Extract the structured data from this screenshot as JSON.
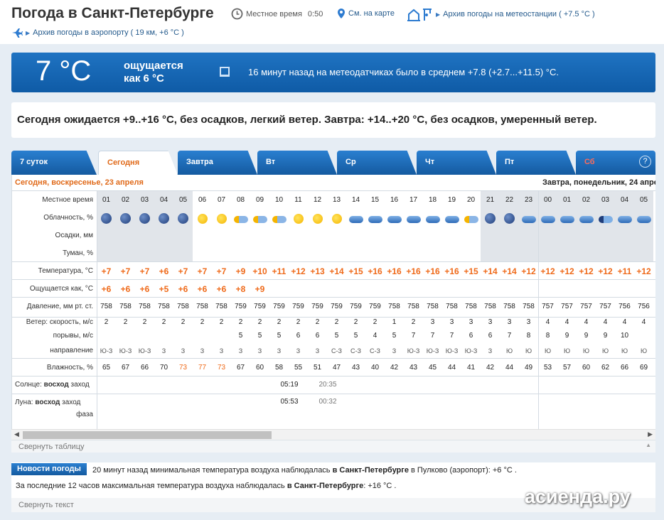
{
  "header": {
    "title": "Погода в Санкт-Петербурге",
    "local_time_label": "Местное время",
    "local_time": "0:50",
    "map_link": "См. на карте",
    "station_archive": "Архив погоды на метеостанции ( +7.5 °C )",
    "airport_archive": "Архив погоды в аэропорту ( 19 км, +6 °C )"
  },
  "current": {
    "temp": "7 °C",
    "feels_line1": "ощущается",
    "feels_line2": "как 6 °C",
    "sensors": "16 минут назад на метеодатчиках было в среднем +7.8 (+2.7...+11.5) °C."
  },
  "summary": "Сегодня ожидается +9..+16 °C, без осадков, легкий ветер. Завтра: +14..+20 °C, без осадков, умеренный ветер.",
  "tabs": [
    "7 суток",
    "Сегодня",
    "Завтра",
    "Вт",
    "Ср",
    "Чт",
    "Пт",
    "Сб"
  ],
  "help_label": "?",
  "table": {
    "today_header": "Сегодня, воскресенье, 23 апреля",
    "tomorrow_header": "Завтра, понедельник, 24 апреля",
    "row_labels": {
      "local_time": "Местное время",
      "cloud": "Облачность, %",
      "precip": "Осадки, мм",
      "fog": "Туман, %",
      "temp": "Температура, °C",
      "feels": "Ощущается как, °C",
      "pressure": "Давление, мм рт. ст.",
      "wind": "Ветер: скорость, м/с",
      "gusts": "порывы, м/с",
      "direction": "направление",
      "humidity": "Влажность, %",
      "sun": "Солнце:",
      "moon": "Луна:",
      "rise": "восход",
      "set": "заход",
      "phase": "фаза"
    },
    "hours": [
      "01",
      "02",
      "03",
      "04",
      "05",
      "06",
      "07",
      "08",
      "09",
      "10",
      "11",
      "12",
      "13",
      "14",
      "15",
      "16",
      "17",
      "18",
      "19",
      "20",
      "21",
      "22",
      "23",
      "00",
      "01",
      "02",
      "03",
      "04",
      "05"
    ],
    "cloud_icons": [
      "moon",
      "moon",
      "moon",
      "moon",
      "moon",
      "sun",
      "sun",
      "sun-cloud",
      "sun-cloud",
      "sun-cloud",
      "sun",
      "sun",
      "sun",
      "cloud",
      "cloud",
      "cloud",
      "cloud",
      "cloud",
      "cloud",
      "sun-cloud",
      "moon",
      "moon",
      "cloud",
      "cloud",
      "cloud",
      "cloud",
      "moon-cloud",
      "cloud",
      "cloud"
    ],
    "temps": [
      "+7",
      "+7",
      "+7",
      "+6",
      "+7",
      "+7",
      "+7",
      "+9",
      "+10",
      "+11",
      "+12",
      "+13",
      "+14",
      "+15",
      "+16",
      "+16",
      "+16",
      "+16",
      "+16",
      "+15",
      "+14",
      "+14",
      "+12",
      "+12",
      "+12",
      "+12",
      "+12",
      "+11",
      "+12"
    ],
    "feels": [
      "+6",
      "+6",
      "+6",
      "+5",
      "+6",
      "+6",
      "+6",
      "+8",
      "+9",
      "",
      "",
      "",
      "",
      "",
      "",
      "",
      "",
      "",
      "",
      "",
      "",
      "",
      "",
      "",
      "",
      "",
      "",
      "",
      ""
    ],
    "pressure": [
      "758",
      "758",
      "758",
      "758",
      "758",
      "758",
      "758",
      "759",
      "759",
      "759",
      "759",
      "759",
      "759",
      "759",
      "759",
      "758",
      "758",
      "758",
      "758",
      "758",
      "758",
      "758",
      "758",
      "757",
      "757",
      "757",
      "757",
      "756",
      "756"
    ],
    "wind": [
      "2",
      "2",
      "2",
      "2",
      "2",
      "2",
      "2",
      "2",
      "2",
      "2",
      "2",
      "2",
      "2",
      "2",
      "2",
      "1",
      "2",
      "3",
      "3",
      "3",
      "3",
      "3",
      "3",
      "4",
      "4",
      "4",
      "4",
      "4",
      "4"
    ],
    "gusts": [
      "",
      "",
      "",
      "",
      "",
      "",
      "",
      "5",
      "5",
      "5",
      "6",
      "6",
      "5",
      "5",
      "4",
      "5",
      "7",
      "7",
      "7",
      "6",
      "6",
      "7",
      "8",
      "8",
      "9",
      "9",
      "9",
      "10"
    ],
    "direction": [
      "Ю-З",
      "Ю-З",
      "Ю-З",
      "З",
      "З",
      "З",
      "З",
      "З",
      "З",
      "З",
      "З",
      "З",
      "С-З",
      "С-З",
      "С-З",
      "З",
      "Ю-З",
      "Ю-З",
      "Ю-З",
      "Ю-З",
      "З",
      "Ю",
      "Ю",
      "Ю",
      "Ю",
      "Ю",
      "Ю",
      "Ю",
      "Ю"
    ],
    "humidity": [
      "65",
      "67",
      "66",
      "70",
      "73",
      "77",
      "73",
      "67",
      "60",
      "58",
      "55",
      "51",
      "47",
      "43",
      "40",
      "42",
      "43",
      "45",
      "44",
      "41",
      "42",
      "44",
      "49",
      "53",
      "57",
      "60",
      "62",
      "66",
      "69"
    ],
    "sunrise": "05:19",
    "sunset": "20:35",
    "moonrise": "05:53",
    "moonset": "00:32"
  },
  "collapse_table": "Свернуть таблицу",
  "news": {
    "badge": "Новости погоды",
    "line1_a": "20 минут назад минимальная температура воздуха наблюдалась ",
    "line1_b": "в Санкт-Петербурге",
    "line1_c": " в Пулково (аэропорт): +6 °C .",
    "line2_a": "За последние 12 часов максимальная температура воздуха наблюдалась ",
    "line2_b": "в Санкт-Петербурге",
    "line2_c": ": +16 °C ."
  },
  "collapse_text": "Свернуть текст",
  "watermark": "асиенда.ру",
  "colors": {
    "accent": "#1565b5",
    "temp": "#ef6a1a",
    "night_shade": "#e1e5ea"
  }
}
